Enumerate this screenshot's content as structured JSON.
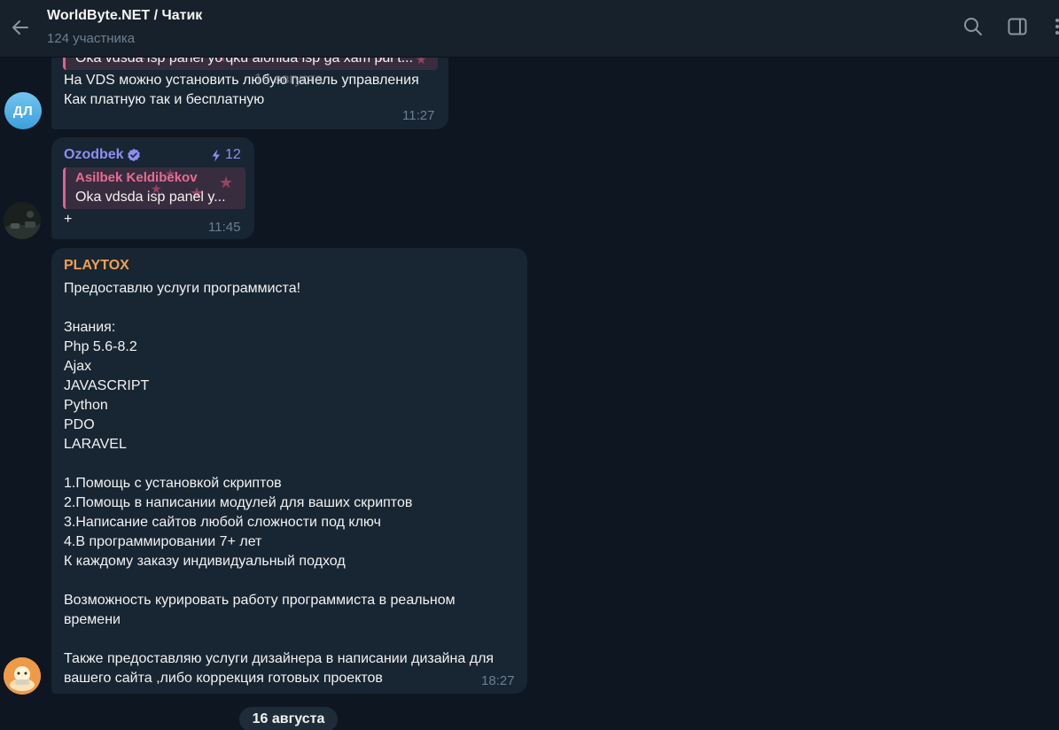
{
  "header": {
    "title": "WorldByte.NET / Чатик",
    "subtitle": "124 участника"
  },
  "floating_date": "14 августа",
  "messages": [
    {
      "avatar_initials": "ДЛ",
      "reply_text": "Oka vdsda isp panel yo'qku alohida isp ga xam pul t...",
      "lines": [
        "На VDS можно установить любую панель управления",
        "Как платную так и бесплатную"
      ],
      "time": "11:27"
    },
    {
      "sender": "Ozodbek",
      "boost_count": "12",
      "reply_name": "Asilbek Keldibekov",
      "reply_text": "Oka vdsda isp panel y...",
      "lines": [
        "+"
      ],
      "time": "11:45"
    },
    {
      "sender": "PLAYTOX",
      "lines": [
        "Предоставлю услуги программиста!",
        "",
        "Знания:",
        "Php 5.6-8.2",
        "Ajax",
        "JAVASCRIPT",
        "Python",
        "PDO",
        "LARAVEL",
        "",
        "1.Помощь с установкой скриптов",
        "2.Помощь в написании модулей для ваших скриптов",
        "3.Написание сайтов любой сложности под ключ",
        "4.В программировании 7+ лет",
        "К каждому заказу индивидуальный подход",
        "",
        "Возможность курировать работу программиста в реальном",
        "времени",
        "",
        "Также предоставляю услуги дизайнера в написании дизайна для",
        "вашего сайта ,либо коррекция готовых проектов"
      ],
      "time": "18:27"
    }
  ],
  "date_separator": "16 августа",
  "colors": {
    "background": "#0e1621",
    "header_bg": "#17212b",
    "bubble_bg": "#182533",
    "ozodbek_name": "#8e8ef0",
    "playtox_name": "#f0a050",
    "reply_accent": "#e0628f",
    "meta_text": "#6d7f8f"
  },
  "icons": [
    "back-arrow-icon",
    "search-icon",
    "sidebar-toggle-icon",
    "more-icon",
    "verified-badge-icon",
    "boost-icon"
  ]
}
